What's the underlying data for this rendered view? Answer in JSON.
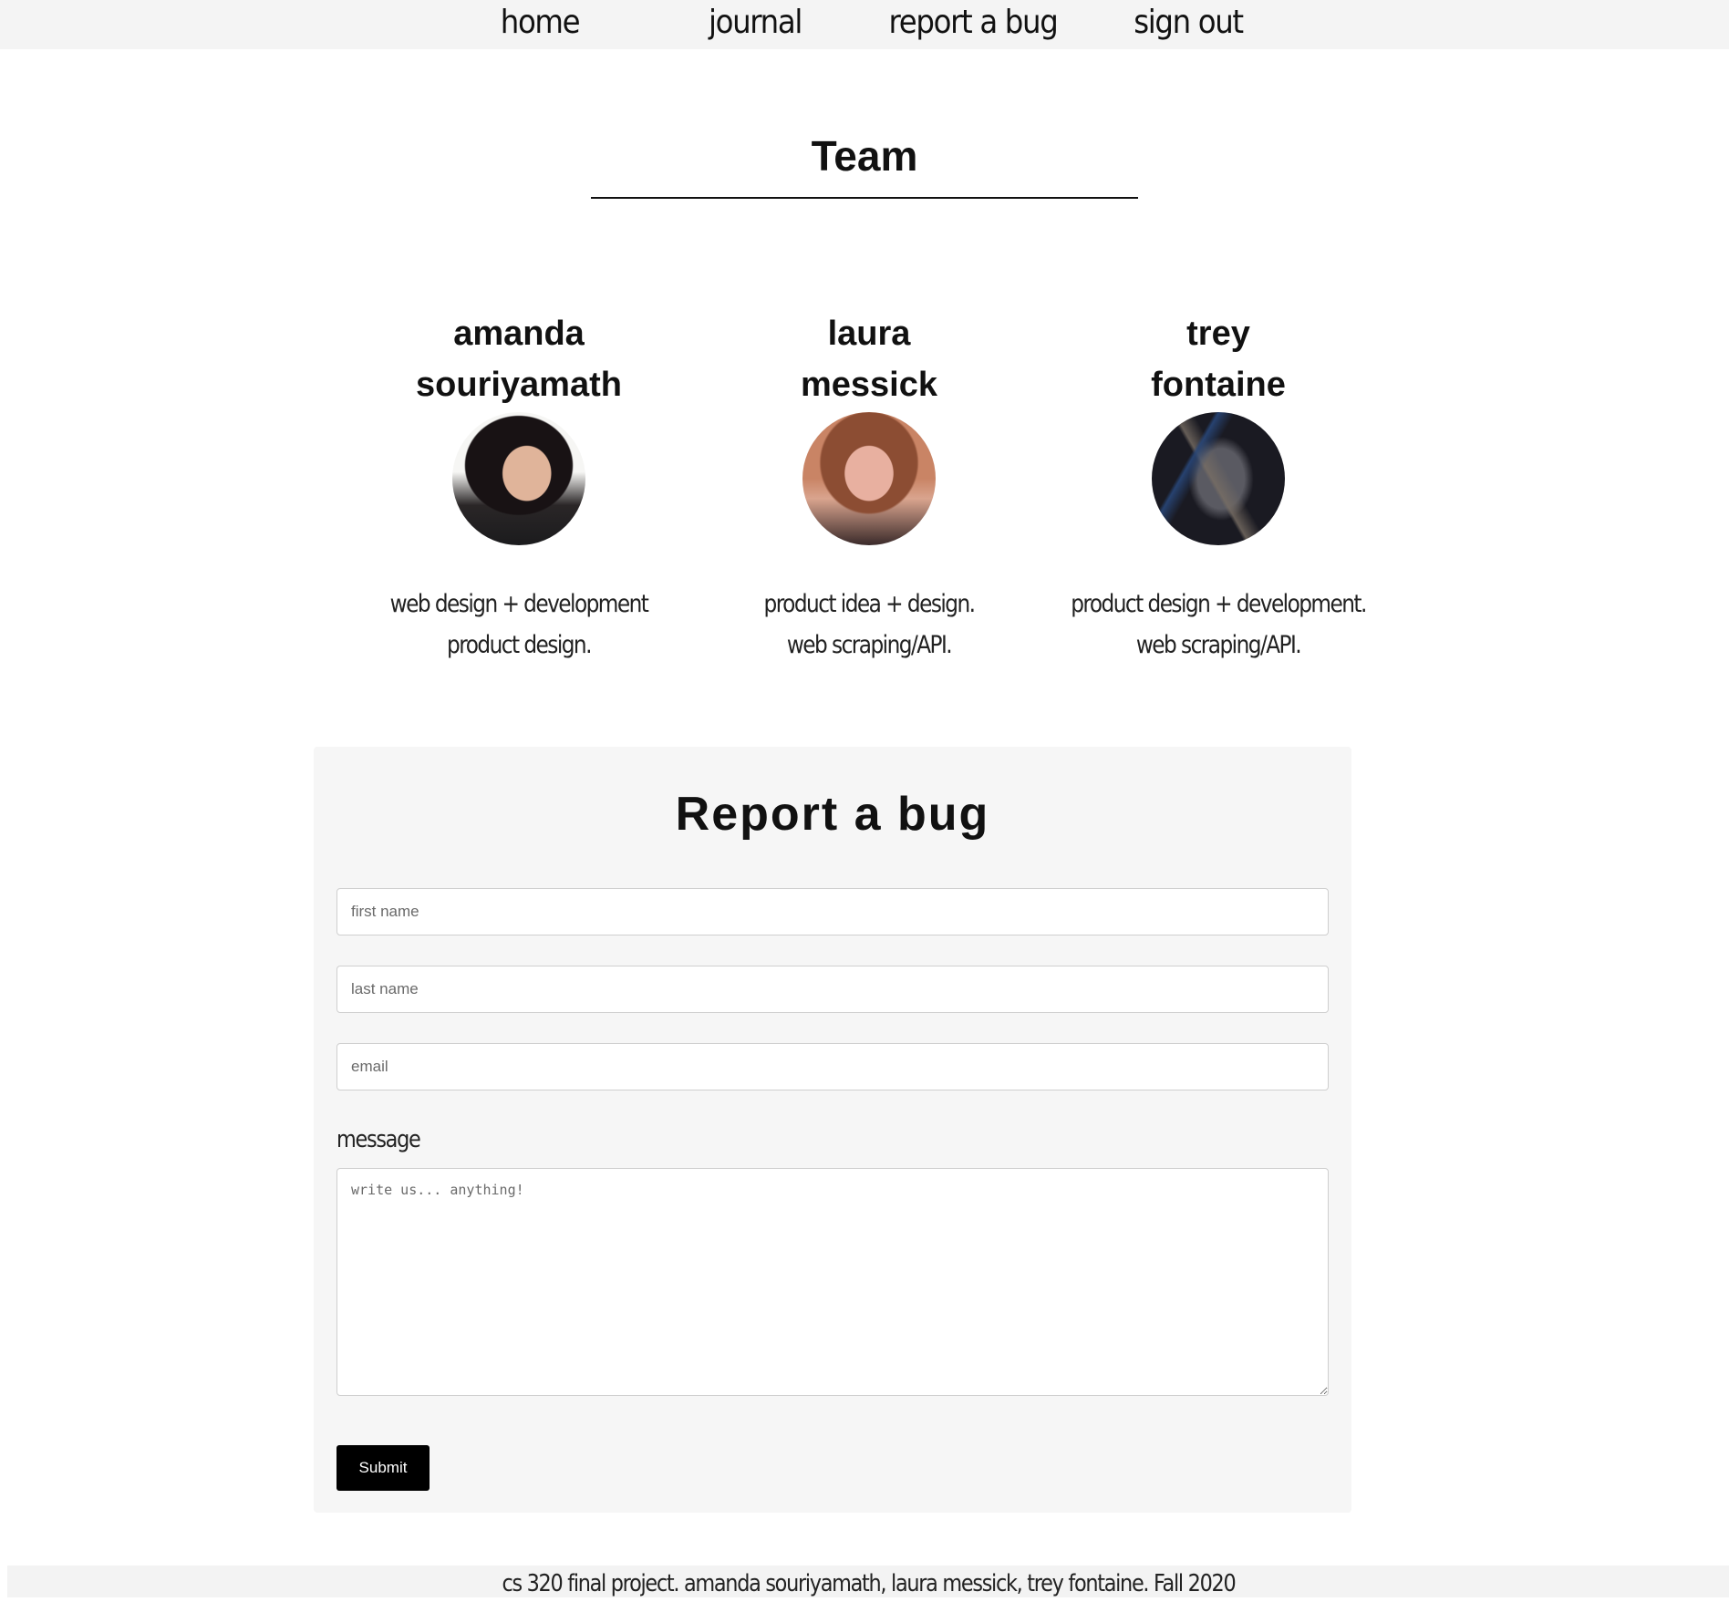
{
  "nav": {
    "home": "home",
    "journal": "journal",
    "report_bug": "report a bug",
    "sign_out": "sign out"
  },
  "team": {
    "title": "Team",
    "members": [
      {
        "first": "amanda",
        "last": "souriyamath",
        "role_line1": "web design + development",
        "role_line2": "product design."
      },
      {
        "first": "laura",
        "last": "messick",
        "role_line1": "product idea + design.",
        "role_line2": "web scraping/API."
      },
      {
        "first": "trey",
        "last": "fontaine",
        "role_line1": "product design + development.",
        "role_line2": "web scraping/API."
      }
    ]
  },
  "bug_form": {
    "title": "Report a bug",
    "first_name_placeholder": "first name",
    "last_name_placeholder": "last name",
    "email_placeholder": "email",
    "message_label": "message",
    "message_placeholder": "write us... anything!",
    "submit_label": "Submit"
  },
  "footer": {
    "text": "cs 320 final project. amanda souriyamath, laura messick, trey fontaine. Fall 2020"
  },
  "colors": {
    "nav_bg": "#f4f4f4",
    "panel_bg": "#f6f6f6",
    "button_bg": "#000000"
  }
}
